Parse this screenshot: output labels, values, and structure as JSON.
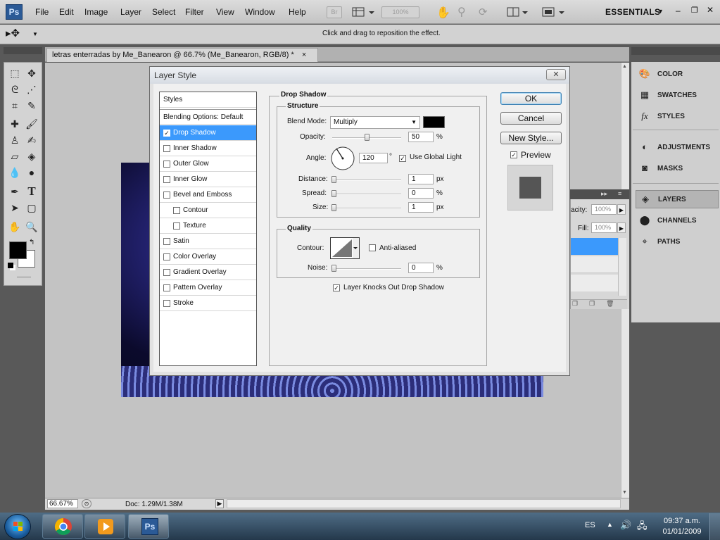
{
  "menubar": {
    "logo": "Ps",
    "items": [
      "File",
      "Edit",
      "Image",
      "Layer",
      "Select",
      "Filter",
      "View",
      "Window",
      "Help"
    ],
    "bridge_label": "Br",
    "zoom_box": "100%",
    "workspace": "ESSENTIALS"
  },
  "options_bar": {
    "hint": "Click and drag to reposition the effect."
  },
  "document": {
    "tab_title": "letras enterradas by Me_Banearon @ 66.7% (Me_Banearon, RGB/8) *",
    "tab_close": "×"
  },
  "status_bar": {
    "zoom": "66.67%",
    "doc_info": "Doc: 1.29M/1.38M"
  },
  "right_dock": {
    "items": [
      {
        "label": "COLOR",
        "icon": "color-palette-icon"
      },
      {
        "label": "SWATCHES",
        "icon": "swatches-icon"
      },
      {
        "label": "STYLES",
        "icon": "styles-fx-icon"
      },
      {
        "label": "ADJUSTMENTS",
        "icon": "adjustments-icon"
      },
      {
        "label": "MASKS",
        "icon": "masks-icon"
      },
      {
        "label": "LAYERS",
        "icon": "layers-icon"
      },
      {
        "label": "CHANNELS",
        "icon": "channels-icon"
      },
      {
        "label": "PATHS",
        "icon": "paths-icon"
      }
    ]
  },
  "layers_panel": {
    "opacity_label": "acity:",
    "opacity_value": "100%",
    "fill_label": "Fill:",
    "fill_value": "100%"
  },
  "dialog": {
    "title": "Layer Style",
    "close": "✕",
    "styles_header": "Styles",
    "blending_options": "Blending Options: Default",
    "style_items": [
      {
        "label": "Drop Shadow",
        "checked": true,
        "selected": true,
        "sub": false
      },
      {
        "label": "Inner Shadow",
        "checked": false,
        "selected": false,
        "sub": false
      },
      {
        "label": "Outer Glow",
        "checked": false,
        "selected": false,
        "sub": false
      },
      {
        "label": "Inner Glow",
        "checked": false,
        "selected": false,
        "sub": false
      },
      {
        "label": "Bevel and Emboss",
        "checked": false,
        "selected": false,
        "sub": false
      },
      {
        "label": "Contour",
        "checked": false,
        "selected": false,
        "sub": true
      },
      {
        "label": "Texture",
        "checked": false,
        "selected": false,
        "sub": true
      },
      {
        "label": "Satin",
        "checked": false,
        "selected": false,
        "sub": false
      },
      {
        "label": "Color Overlay",
        "checked": false,
        "selected": false,
        "sub": false
      },
      {
        "label": "Gradient Overlay",
        "checked": false,
        "selected": false,
        "sub": false
      },
      {
        "label": "Pattern Overlay",
        "checked": false,
        "selected": false,
        "sub": false
      },
      {
        "label": "Stroke",
        "checked": false,
        "selected": false,
        "sub": false
      }
    ],
    "panel_title": "Drop Shadow",
    "structure": {
      "title": "Structure",
      "blend_mode_label": "Blend Mode:",
      "blend_mode_value": "Multiply",
      "shadow_color": "#000000",
      "opacity_label": "Opacity:",
      "opacity_value": "50",
      "opacity_fraction": 0.5,
      "opacity_unit": "%",
      "angle_label": "Angle:",
      "angle_value": "120",
      "angle_unit": "°",
      "use_global_light": "Use Global Light",
      "use_global_light_checked": true,
      "distance_label": "Distance:",
      "distance_value": "1",
      "distance_unit": "px",
      "spread_label": "Spread:",
      "spread_value": "0",
      "spread_unit": "%",
      "size_label": "Size:",
      "size_value": "1",
      "size_unit": "px"
    },
    "quality": {
      "title": "Quality",
      "contour_label": "Contour:",
      "anti_aliased": "Anti-aliased",
      "anti_aliased_checked": false,
      "noise_label": "Noise:",
      "noise_value": "0",
      "noise_unit": "%",
      "knocks_out": "Layer Knocks Out Drop Shadow",
      "knocks_out_checked": true
    },
    "buttons": {
      "ok": "OK",
      "cancel": "Cancel",
      "new_style": "New Style...",
      "preview": "Preview",
      "preview_checked": true
    }
  },
  "taskbar": {
    "language": "ES",
    "time": "09:37 a.m.",
    "date": "01/01/2009",
    "ps_label": "Ps"
  },
  "colors": {
    "accent": "#3b99fc",
    "foreground_swatch": "#000000",
    "background_swatch": "#ffffff"
  }
}
